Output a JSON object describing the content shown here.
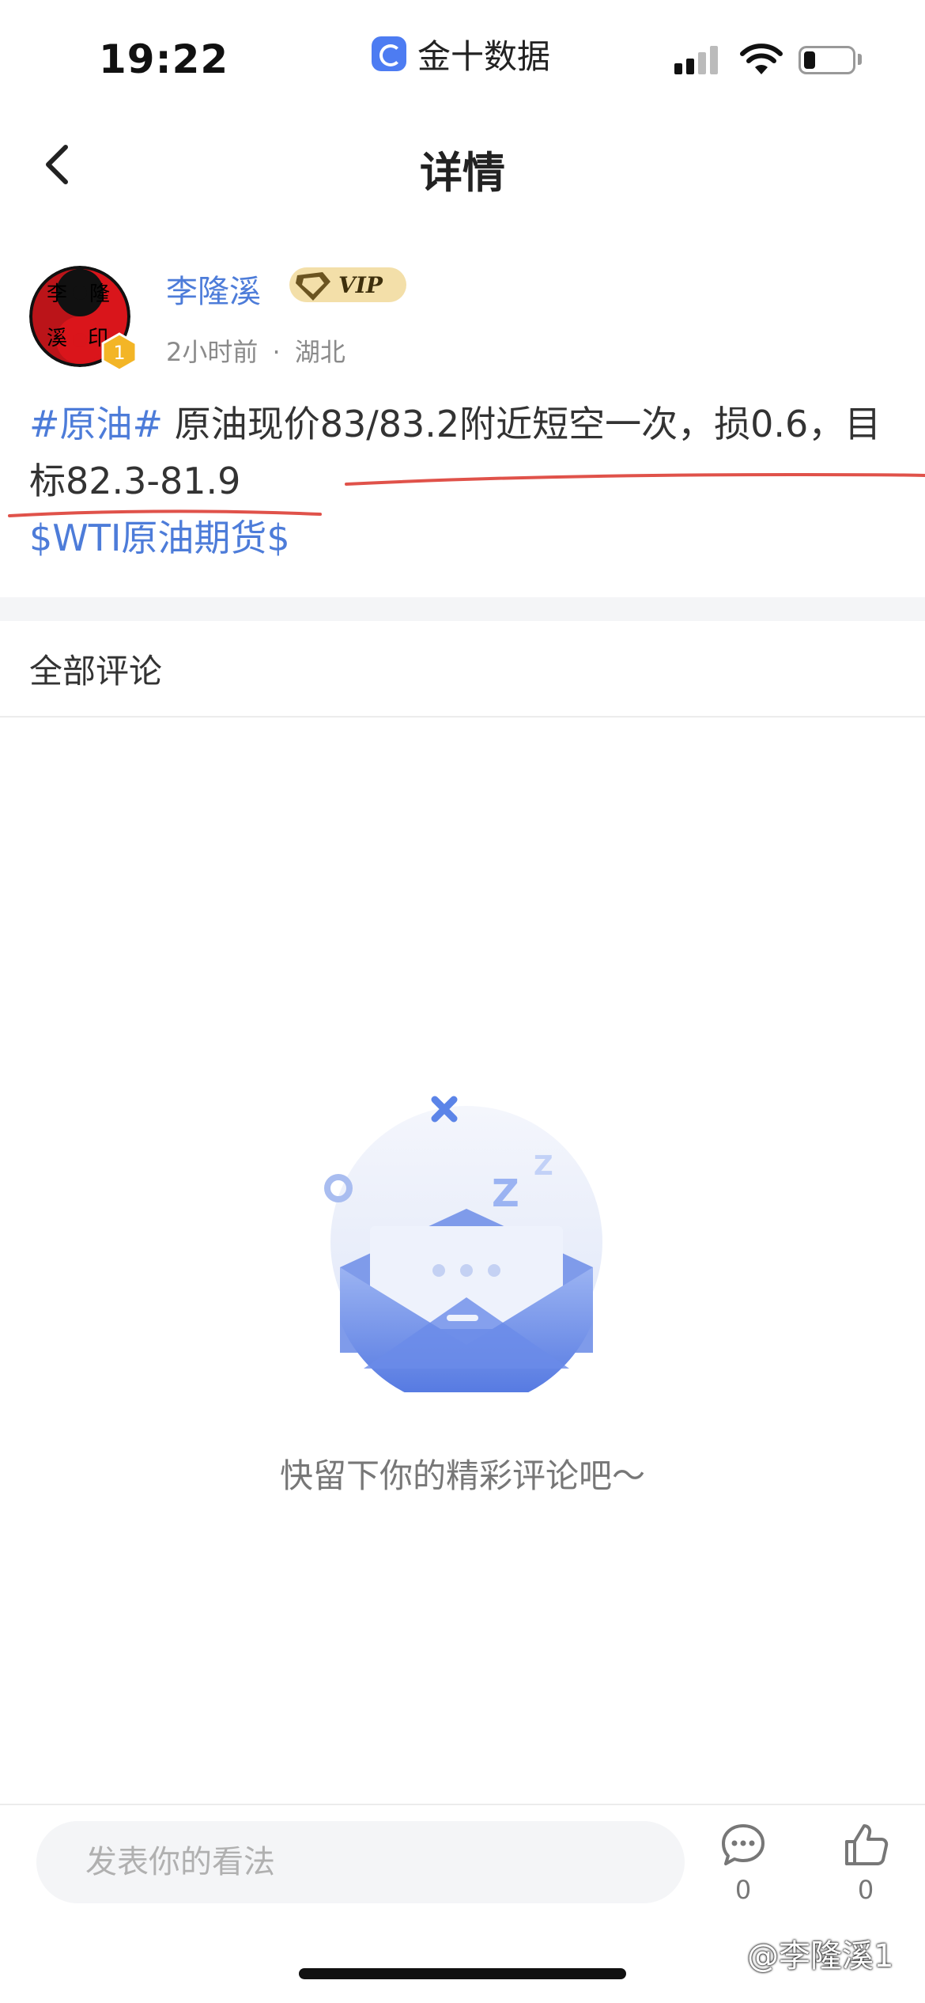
{
  "status": {
    "time": "19:22",
    "app_name": "金十数据"
  },
  "nav": {
    "title": "详情"
  },
  "post": {
    "author": "李隆溪",
    "vip_label": "VIP",
    "level": "1",
    "avatar_text": [
      "李",
      "隆",
      "溪",
      "印"
    ],
    "time_ago": "2小时前",
    "separator": "·",
    "location": "湖北",
    "hashtag": "#原油#",
    "body": " 原油现价83/83.2附近短空一次，损0.6，目标82.3-81.9",
    "stock_tag": "$WTI原油期货$"
  },
  "comments": {
    "header": "全部评论",
    "empty_text": "快留下你的精彩评论吧～"
  },
  "bottom_bar": {
    "input_placeholder": "发表你的看法",
    "comment_count": "0",
    "like_count": "0"
  },
  "watermark": "@李隆溪1",
  "colors": {
    "link": "#4d7cd9",
    "annotation": "#e0524a",
    "illustration": "#5b84e8"
  },
  "icons": [
    "back-arrow-icon",
    "comment-bubble-icon",
    "thumbs-up-icon",
    "vip-diamond-icon"
  ]
}
